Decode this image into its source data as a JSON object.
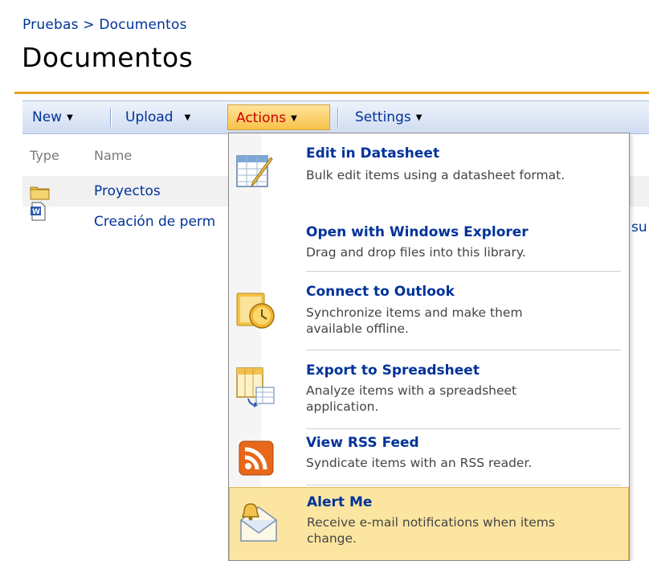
{
  "breadcrumb": {
    "parent": "Pruebas",
    "separator": ">",
    "current": "Documentos"
  },
  "page_title": "Documentos",
  "toolbar": {
    "new_label": "New",
    "upload_label": "Upload",
    "actions_label": "Actions",
    "settings_label": "Settings"
  },
  "list": {
    "columns": [
      "Type",
      "Name"
    ],
    "rows": [
      {
        "name": "Proyectos",
        "icon": "folder-icon"
      },
      {
        "name": "Creación de perm",
        "icon": "word-document-icon"
      }
    ],
    "trailing_fragment": "su"
  },
  "actions_menu": {
    "items": [
      {
        "title": "Edit in Datasheet",
        "description": "Bulk edit items using a datasheet format.",
        "icon": "datasheet-icon"
      },
      {
        "title": "Open with Windows Explorer",
        "description": "Drag and drop files into this library.",
        "icon": ""
      },
      {
        "title": "Connect to Outlook",
        "description": "Synchronize items and make them available offline.",
        "icon": "outlook-icon"
      },
      {
        "title": "Export to Spreadsheet",
        "description": "Analyze items with a spreadsheet application.",
        "icon": "spreadsheet-icon"
      },
      {
        "title": "View RSS Feed",
        "description": "Syndicate items with an RSS reader.",
        "icon": "rss-icon"
      },
      {
        "title": "Alert Me",
        "description": "Receive e-mail notifications when items change.",
        "icon": "alert-bell-icon"
      }
    ]
  },
  "colors": {
    "link": "#003399",
    "accent_rule": "#e6a41e",
    "menu_hover": "#fbe5a1",
    "active_button_text": "#cc0000"
  }
}
